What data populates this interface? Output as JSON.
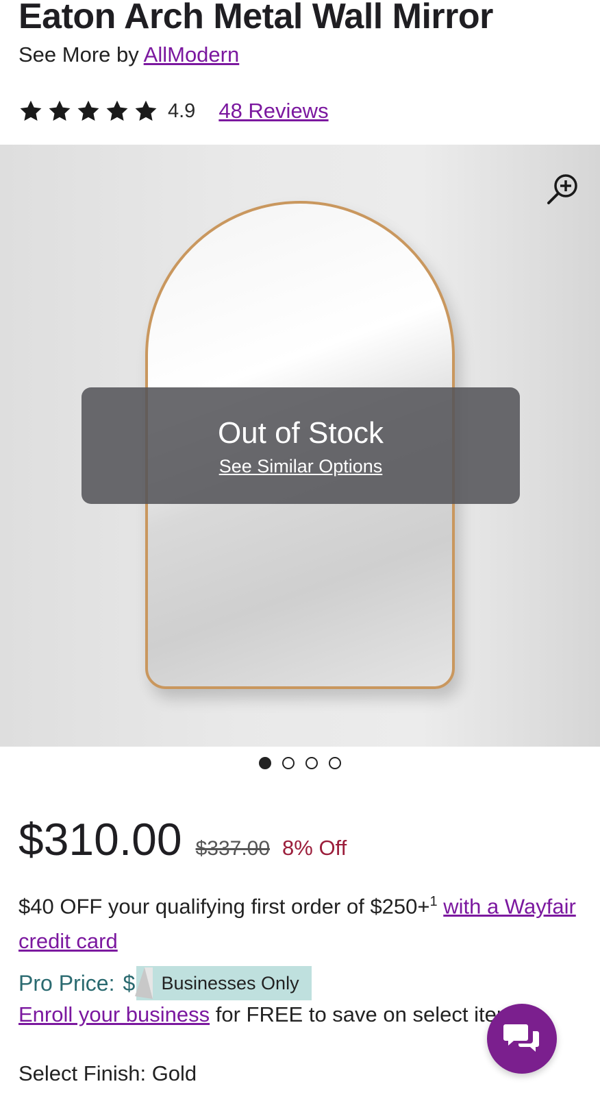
{
  "product": {
    "title": "Eaton Arch Metal Wall Mirror",
    "see_more_prefix": "See More by",
    "brand": "AllModern",
    "rating": "4.9",
    "rating_stars": 5,
    "reviews_label": "48 Reviews"
  },
  "gallery": {
    "status_title": "Out of Stock",
    "status_link": "See Similar Options",
    "image_count": 4,
    "active_index": 0,
    "zoom_icon": "zoom-in-icon"
  },
  "pricing": {
    "price": "$310.00",
    "original_price": "$337.00",
    "discount": "8% Off",
    "promo_text": "$40 OFF your qualifying first order of $250+",
    "promo_superscript": "1",
    "promo_link": "with a Wayfair credit card",
    "pro_label": "Pro Price:",
    "pro_value_visible": "$",
    "pro_badge": "Businesses Only",
    "enroll_link": "Enroll your business",
    "enroll_text": "for FREE to save on select items."
  },
  "options": {
    "finish_label": "Select Finish: Gold"
  },
  "chat": {
    "icon": "chat-bubbles-icon"
  },
  "colors": {
    "accent": "#7b189f",
    "discount": "#9b1d3a",
    "pro": "#2a6a70",
    "badge": "#bfe0de",
    "chat": "#7b1f8e",
    "mirror_frame": "#c9975e"
  }
}
